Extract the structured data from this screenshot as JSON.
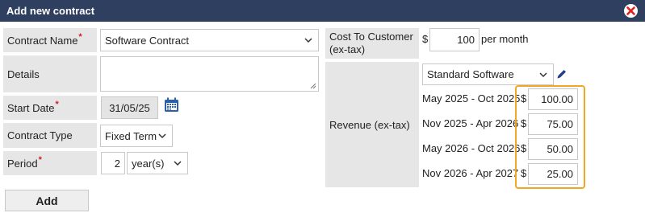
{
  "dialog": {
    "title": "Add new contract",
    "close_icon": "close-icon",
    "accent_close": "#e02020",
    "titlebar_color": "#2f3f5f"
  },
  "form": {
    "contract_name": {
      "label": "Contract Name",
      "required_mark": "*",
      "value": "Software Contract"
    },
    "details": {
      "label": "Details",
      "value": ""
    },
    "start_date": {
      "label": "Start Date",
      "required_mark": "*",
      "value": "31/05/25",
      "icon": "calendar-icon"
    },
    "contract_type": {
      "label": "Contract Type",
      "value": "Fixed Term"
    },
    "period": {
      "label": "Period",
      "required_mark": "*",
      "count": "2",
      "unit": "year(s)"
    },
    "add_button": "Add"
  },
  "pricing": {
    "cost_label_line1": "Cost To Customer",
    "cost_label_line2": "(ex-tax)",
    "currency": "$",
    "cost_value": "100",
    "cost_unit": "per month",
    "revenue_label": "Revenue (ex-tax)",
    "product": "Standard Software",
    "edit_icon": "pencil-icon",
    "highlight_color": "#f0a824",
    "revenue_rows": [
      {
        "period": "May 2025 - Oct 2025",
        "currency": "$",
        "amount": "100.00"
      },
      {
        "period": "Nov 2025 - Apr 2026",
        "currency": "$",
        "amount": "75.00"
      },
      {
        "period": "May 2026 - Oct 2026",
        "currency": "$",
        "amount": "50.00"
      },
      {
        "period": "Nov 2026 - Apr 2027",
        "currency": "$",
        "amount": "25.00"
      }
    ]
  }
}
